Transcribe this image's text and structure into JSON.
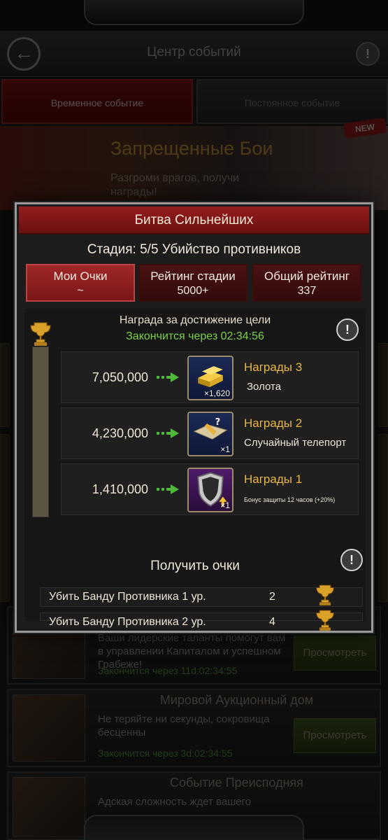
{
  "header": {
    "title": "Центр событий",
    "back_icon": "←",
    "info_icon": "!"
  },
  "tabs": [
    {
      "label": "Временное событие",
      "active": true
    },
    {
      "label": "Постоянное событие",
      "active": false
    }
  ],
  "banner": {
    "title": "Запрещенные Бои",
    "subtitle": "Разгроми врагов, получи награды!",
    "badge": "NEW"
  },
  "events": [
    {
      "title": "",
      "description": "Ваши лидерские таланты помогут вам в управлении Капиталом и успешном Грабеже!",
      "timer": "Закончится через 11d:02:34:55",
      "button": "Просмотреть"
    },
    {
      "title": "Мировой Аукционный дом",
      "description": "Не теряйте ни секунды, сокровища бесценны",
      "timer": "Закончится через 3d:02:34:55",
      "button": "Просмотреть"
    },
    {
      "title": "Событие Преисподняя",
      "description": "Адская сложность ждет вашего",
      "timer": "",
      "button": ""
    }
  ],
  "modal": {
    "title": "Битва Сильнейших",
    "stage": "Стадия: 5/5 Убийство противников",
    "scores": [
      {
        "label": "Мои Очки",
        "value": "~",
        "active": true
      },
      {
        "label": "Рейтинг стадии",
        "value": "5000+",
        "active": false
      },
      {
        "label": "Общий рейтинг",
        "value": "337",
        "active": false
      }
    ],
    "reward_header": "Награда за достижение цели",
    "reward_timer": "Закончится через 02:34:56",
    "info_icon": "!",
    "progress": 0,
    "rewards": [
      {
        "points": "7,050,000",
        "name": "Награды 3",
        "desc": "Золота",
        "qty": "×1,620",
        "icon": "gold-bars-icon"
      },
      {
        "points": "4,230,000",
        "name": "Награды 2",
        "desc": "Случайный телепорт",
        "qty": "×1",
        "icon": "random-teleport-icon"
      },
      {
        "points": "1,410,000",
        "name": "Награды 1",
        "desc": "Бонус защиты 12 часов (+20%)",
        "qty": "×1",
        "icon": "defense-shield-icon"
      }
    ],
    "get_points_title": "Получить очки",
    "tasks": [
      {
        "label": "Убить Банду Противника 1 ур.",
        "value": "2"
      },
      {
        "label": "Убить Банду Противника 2 ур.",
        "value": "4"
      }
    ]
  },
  "colors": {
    "accent_red": "#951d1d",
    "timer_green": "#7ed04a",
    "reward_gold": "#e8b640"
  }
}
